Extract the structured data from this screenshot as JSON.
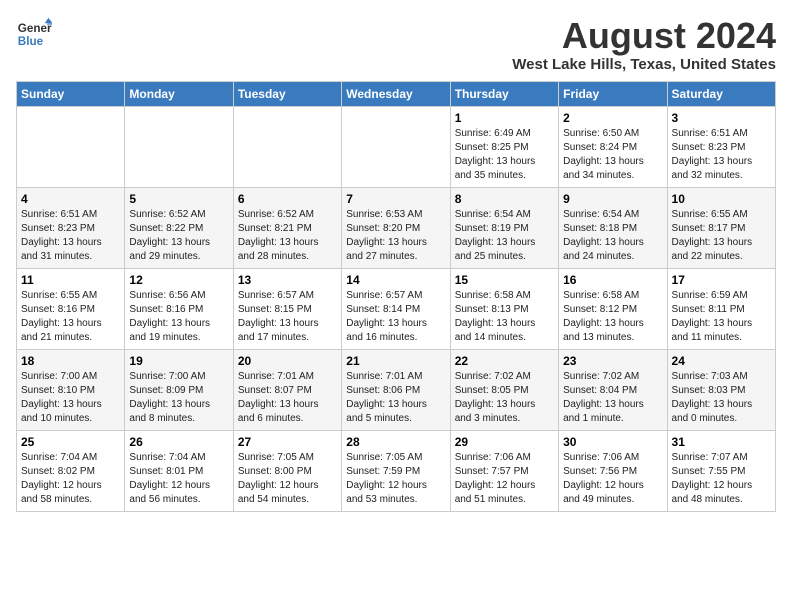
{
  "logo": {
    "line1": "General",
    "line2": "Blue"
  },
  "title": {
    "month_year": "August 2024",
    "location": "West Lake Hills, Texas, United States"
  },
  "days_of_week": [
    "Sunday",
    "Monday",
    "Tuesday",
    "Wednesday",
    "Thursday",
    "Friday",
    "Saturday"
  ],
  "weeks": [
    [
      {
        "day": "",
        "info": ""
      },
      {
        "day": "",
        "info": ""
      },
      {
        "day": "",
        "info": ""
      },
      {
        "day": "",
        "info": ""
      },
      {
        "day": "1",
        "info": "Sunrise: 6:49 AM\nSunset: 8:25 PM\nDaylight: 13 hours\nand 35 minutes."
      },
      {
        "day": "2",
        "info": "Sunrise: 6:50 AM\nSunset: 8:24 PM\nDaylight: 13 hours\nand 34 minutes."
      },
      {
        "day": "3",
        "info": "Sunrise: 6:51 AM\nSunset: 8:23 PM\nDaylight: 13 hours\nand 32 minutes."
      }
    ],
    [
      {
        "day": "4",
        "info": "Sunrise: 6:51 AM\nSunset: 8:23 PM\nDaylight: 13 hours\nand 31 minutes."
      },
      {
        "day": "5",
        "info": "Sunrise: 6:52 AM\nSunset: 8:22 PM\nDaylight: 13 hours\nand 29 minutes."
      },
      {
        "day": "6",
        "info": "Sunrise: 6:52 AM\nSunset: 8:21 PM\nDaylight: 13 hours\nand 28 minutes."
      },
      {
        "day": "7",
        "info": "Sunrise: 6:53 AM\nSunset: 8:20 PM\nDaylight: 13 hours\nand 27 minutes."
      },
      {
        "day": "8",
        "info": "Sunrise: 6:54 AM\nSunset: 8:19 PM\nDaylight: 13 hours\nand 25 minutes."
      },
      {
        "day": "9",
        "info": "Sunrise: 6:54 AM\nSunset: 8:18 PM\nDaylight: 13 hours\nand 24 minutes."
      },
      {
        "day": "10",
        "info": "Sunrise: 6:55 AM\nSunset: 8:17 PM\nDaylight: 13 hours\nand 22 minutes."
      }
    ],
    [
      {
        "day": "11",
        "info": "Sunrise: 6:55 AM\nSunset: 8:16 PM\nDaylight: 13 hours\nand 21 minutes."
      },
      {
        "day": "12",
        "info": "Sunrise: 6:56 AM\nSunset: 8:16 PM\nDaylight: 13 hours\nand 19 minutes."
      },
      {
        "day": "13",
        "info": "Sunrise: 6:57 AM\nSunset: 8:15 PM\nDaylight: 13 hours\nand 17 minutes."
      },
      {
        "day": "14",
        "info": "Sunrise: 6:57 AM\nSunset: 8:14 PM\nDaylight: 13 hours\nand 16 minutes."
      },
      {
        "day": "15",
        "info": "Sunrise: 6:58 AM\nSunset: 8:13 PM\nDaylight: 13 hours\nand 14 minutes."
      },
      {
        "day": "16",
        "info": "Sunrise: 6:58 AM\nSunset: 8:12 PM\nDaylight: 13 hours\nand 13 minutes."
      },
      {
        "day": "17",
        "info": "Sunrise: 6:59 AM\nSunset: 8:11 PM\nDaylight: 13 hours\nand 11 minutes."
      }
    ],
    [
      {
        "day": "18",
        "info": "Sunrise: 7:00 AM\nSunset: 8:10 PM\nDaylight: 13 hours\nand 10 minutes."
      },
      {
        "day": "19",
        "info": "Sunrise: 7:00 AM\nSunset: 8:09 PM\nDaylight: 13 hours\nand 8 minutes."
      },
      {
        "day": "20",
        "info": "Sunrise: 7:01 AM\nSunset: 8:07 PM\nDaylight: 13 hours\nand 6 minutes."
      },
      {
        "day": "21",
        "info": "Sunrise: 7:01 AM\nSunset: 8:06 PM\nDaylight: 13 hours\nand 5 minutes."
      },
      {
        "day": "22",
        "info": "Sunrise: 7:02 AM\nSunset: 8:05 PM\nDaylight: 13 hours\nand 3 minutes."
      },
      {
        "day": "23",
        "info": "Sunrise: 7:02 AM\nSunset: 8:04 PM\nDaylight: 13 hours\nand 1 minute."
      },
      {
        "day": "24",
        "info": "Sunrise: 7:03 AM\nSunset: 8:03 PM\nDaylight: 13 hours\nand 0 minutes."
      }
    ],
    [
      {
        "day": "25",
        "info": "Sunrise: 7:04 AM\nSunset: 8:02 PM\nDaylight: 12 hours\nand 58 minutes."
      },
      {
        "day": "26",
        "info": "Sunrise: 7:04 AM\nSunset: 8:01 PM\nDaylight: 12 hours\nand 56 minutes."
      },
      {
        "day": "27",
        "info": "Sunrise: 7:05 AM\nSunset: 8:00 PM\nDaylight: 12 hours\nand 54 minutes."
      },
      {
        "day": "28",
        "info": "Sunrise: 7:05 AM\nSunset: 7:59 PM\nDaylight: 12 hours\nand 53 minutes."
      },
      {
        "day": "29",
        "info": "Sunrise: 7:06 AM\nSunset: 7:57 PM\nDaylight: 12 hours\nand 51 minutes."
      },
      {
        "day": "30",
        "info": "Sunrise: 7:06 AM\nSunset: 7:56 PM\nDaylight: 12 hours\nand 49 minutes."
      },
      {
        "day": "31",
        "info": "Sunrise: 7:07 AM\nSunset: 7:55 PM\nDaylight: 12 hours\nand 48 minutes."
      }
    ]
  ]
}
